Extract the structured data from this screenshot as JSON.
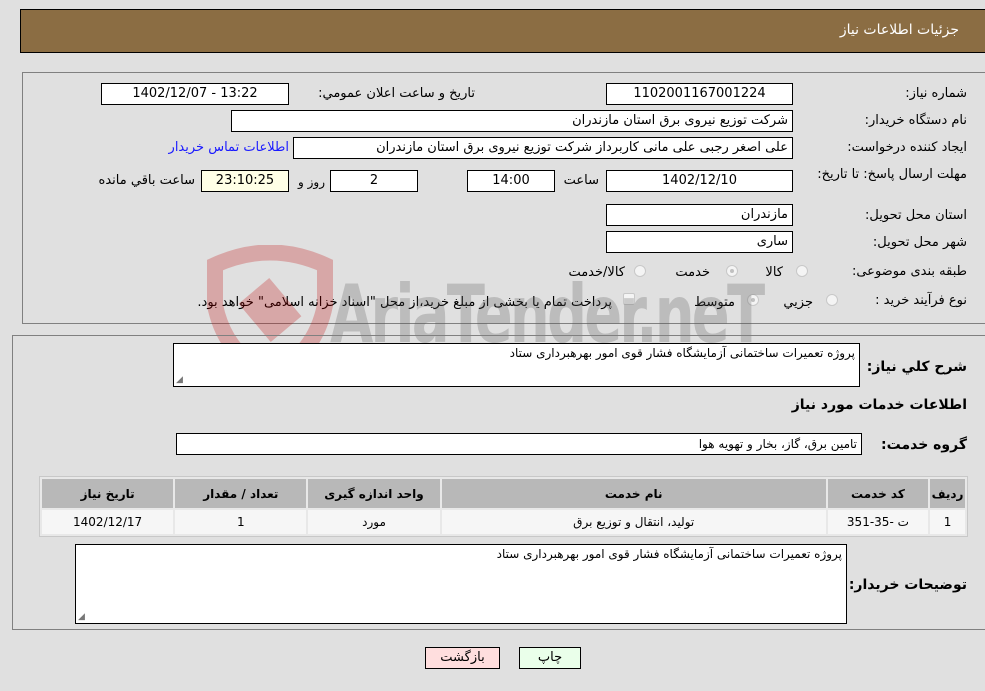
{
  "header": {
    "title": "جزئیات اطلاعات نیاز"
  },
  "form": {
    "need_number_label": "شماره نیاز:",
    "need_number": "1102001167001224",
    "announce_label": "تاریخ و ساعت اعلان عمومي:",
    "announce_value": "1402/12/07 - 13:22",
    "buyer_org_label": "نام دستگاه خریدار:",
    "buyer_org": "شرکت توزیع نیروی برق استان مازندران",
    "creator_label": "ایجاد کننده درخواست:",
    "creator": "علی اصغر رجبی علی مانی کاربرداز شرکت توزیع نیروی برق استان مازندران",
    "contact_link": "اطلاعات تماس خریدار",
    "deadline_label": "مهلت ارسال پاسخ: تا تاریخ:",
    "deadline_date": "1402/12/10",
    "time_label": "ساعت",
    "deadline_time": "14:00",
    "days_value": "2",
    "days_label": "روز و",
    "remaining_time": "23:10:25",
    "remaining_label": "ساعت باقي مانده",
    "province_label": "استان محل تحویل:",
    "province": "مازندران",
    "city_label": "شهر محل تحویل:",
    "city": "ساری",
    "category_label": "طبقه بندی موضوعی:",
    "category_options": [
      "کالا",
      "خدمت",
      "کالا/خدمت"
    ],
    "category_selected": "خدمت",
    "process_label": "نوع فرآیند خرید :",
    "process_options": [
      "جزيي",
      "متوسط"
    ],
    "process_selected": "متوسط",
    "treasury_note": "پرداخت تمام یا بخشی از مبلغ خرید،از محل \"اسناد خزانه اسلامی\" خواهد بود."
  },
  "details": {
    "summary_label": "شرح کلي نياز:",
    "summary": "پروژه تعمیرات ساختمانی آزمایشگاه فشار قوی امور بهرهبرداری ستاد",
    "services_heading": "اطلاعات خدمات مورد نياز",
    "service_group_label": "گروه خدمت:",
    "service_group": "تامین برق، گاز، بخار و تهویه هوا",
    "table": {
      "headers": [
        "ردیف",
        "کد خدمت",
        "نام خدمت",
        "واحد اندازه گیری",
        "تعداد / مقدار",
        "تاریخ نیاز"
      ],
      "rows": [
        [
          "1",
          "ت -35-351",
          "تولید، انتقال و توزیع برق",
          "مورد",
          "1",
          "1402/12/17"
        ]
      ]
    },
    "buyer_notes_label": "توضیحات خریدار:",
    "buyer_notes": "پروژه تعمیرات ساختمانی آزمایشگاه فشار قوی امور بهرهبرداری ستاد"
  },
  "buttons": {
    "print": "چاپ",
    "back": "بازگشت"
  },
  "watermark": {
    "text": "AriaTender.neT"
  }
}
